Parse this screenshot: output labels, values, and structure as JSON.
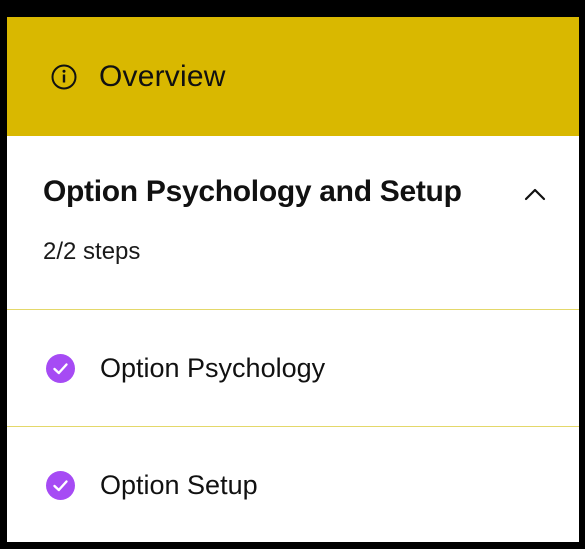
{
  "overview": {
    "icon": "info-icon",
    "label": "Overview",
    "background_color": "#d9b800"
  },
  "section": {
    "title": "Option Psychology and Setup",
    "progress_text": "2/2 steps",
    "expanded": true,
    "toggle_icon": "chevron-up-icon"
  },
  "steps": [
    {
      "label": "Option Psychology",
      "completed": true,
      "icon": "check-circle-icon"
    },
    {
      "label": "Option Setup",
      "completed": true,
      "icon": "check-circle-icon"
    }
  ],
  "colors": {
    "completed_check": "#a64bf4",
    "divider": "#e4d86a"
  }
}
